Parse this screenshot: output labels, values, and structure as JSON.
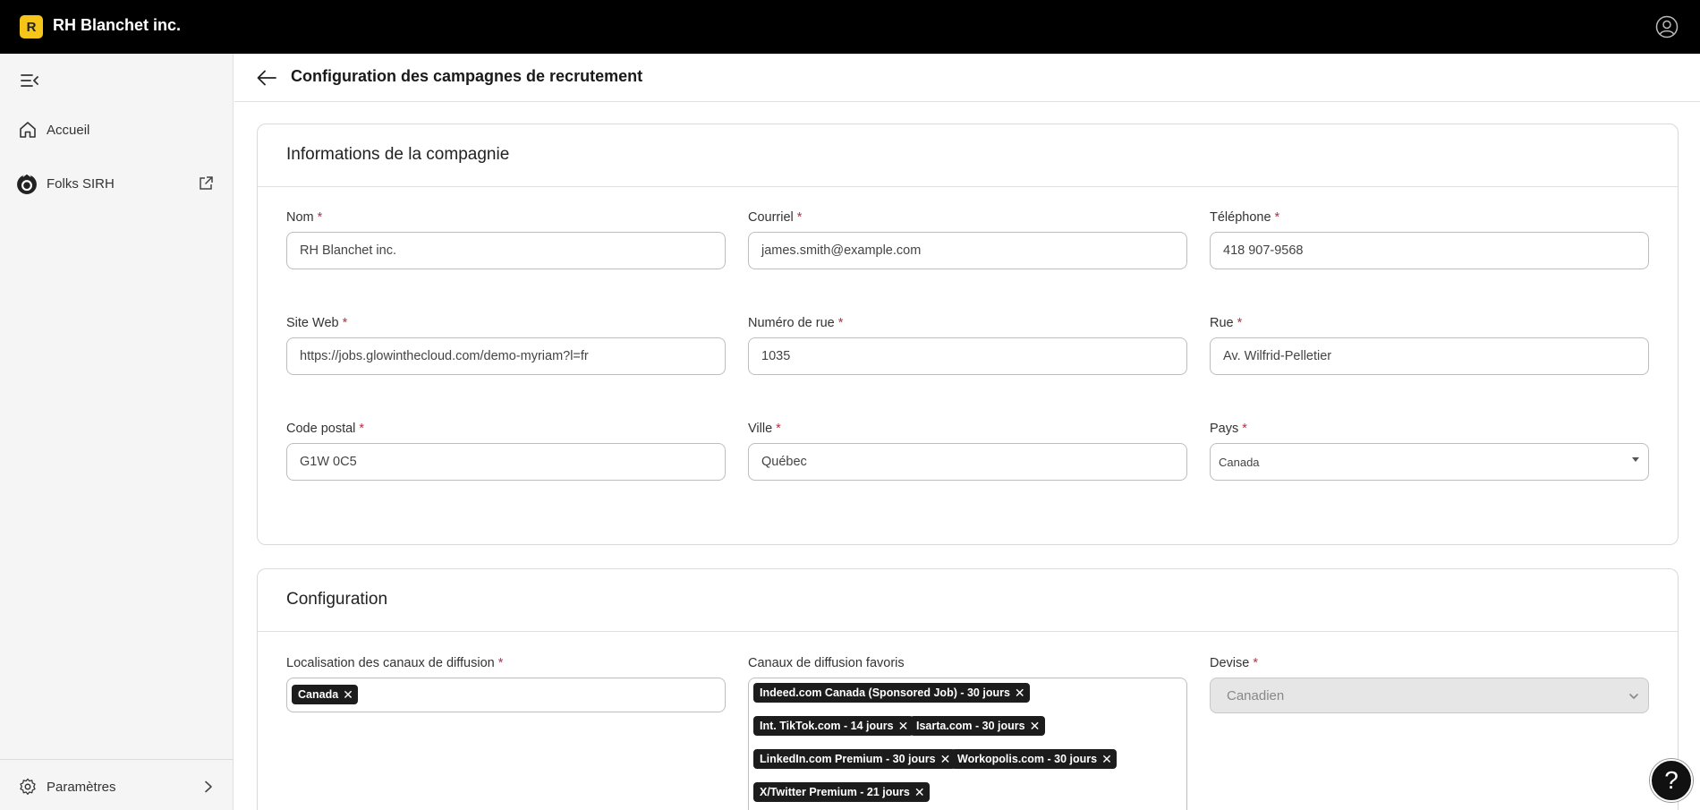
{
  "app": {
    "logo_letter": "R",
    "title": "RH Blanchet inc."
  },
  "sidebar": {
    "items": [
      {
        "label": "Accueil",
        "icon": "home-icon"
      },
      {
        "label": "Folks SIRH",
        "icon": "folks-logo-icon"
      }
    ],
    "settings_label": "Paramètres"
  },
  "header": {
    "title": "Configuration des campagnes de recrutement"
  },
  "company": {
    "title": "Informations de la compagnie",
    "required_mark": "*",
    "fields": {
      "name": {
        "label": "Nom",
        "value": "RH Blanchet inc."
      },
      "email": {
        "label": "Courriel",
        "value": "james.smith@example.com"
      },
      "phone": {
        "label": "Téléphone",
        "value": "418 907-9568"
      },
      "website": {
        "label": "Site Web",
        "value": "https://jobs.glowinthecloud.com/demo-myriam?l=fr"
      },
      "street_number": {
        "label": "Numéro de rue",
        "value": "1035"
      },
      "street": {
        "label": "Rue",
        "value": "Av. Wilfrid-Pelletier"
      },
      "postal_code": {
        "label": "Code postal",
        "value": "G1W 0C5"
      },
      "city": {
        "label": "Ville",
        "value": "Québec"
      },
      "country": {
        "label": "Pays",
        "value": "Canada"
      }
    }
  },
  "configuration": {
    "title": "Configuration",
    "location": {
      "label": "Localisation des canaux de diffusion",
      "tags": [
        "Canada"
      ]
    },
    "channels": {
      "label": "Canaux de diffusion favoris",
      "tags": [
        "Indeed.com Canada (Sponsored Job) - 30 jours",
        "Int. TikTok.com - 14 jours",
        "Isarta.com - 30 jours",
        "LinkedIn.com Premium - 30 jours",
        "Workopolis.com - 30 jours",
        "X/Twitter Premium - 21 jours"
      ]
    },
    "currency": {
      "label": "Devise",
      "value": "Canadien"
    }
  },
  "help": {
    "label": "?"
  },
  "tag_remove_glyph": "✕"
}
